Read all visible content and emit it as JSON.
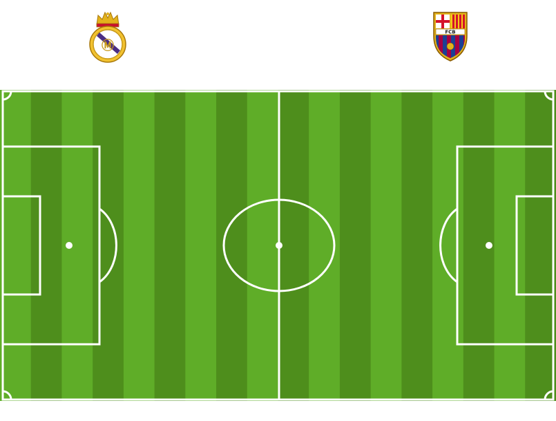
{
  "home_team": {
    "crest_icon": "real-madrid-crest-icon",
    "crest_letters": "MCF"
  },
  "away_team": {
    "crest_icon": "fc-barcelona-crest-icon",
    "crest_letters": "FCB"
  },
  "pitch": {
    "stripe_count": 18,
    "colors": {
      "light_stripe": "#5fad28",
      "dark_stripe": "#4e8e1c",
      "lines": "#ffffff"
    }
  }
}
